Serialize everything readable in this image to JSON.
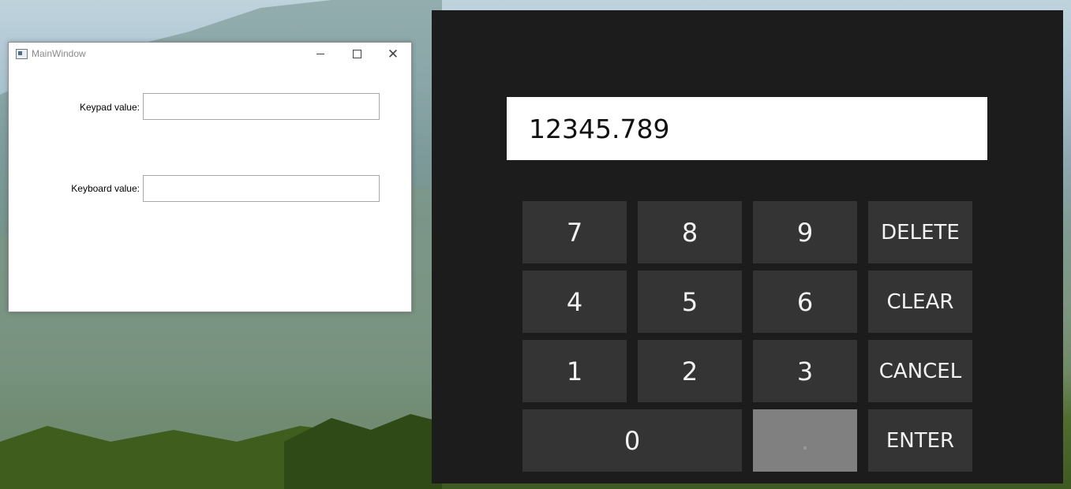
{
  "window": {
    "title": "MainWindow",
    "fields": [
      {
        "label": "Keypad value:",
        "value": ""
      },
      {
        "label": "Keyboard value:",
        "value": ""
      }
    ]
  },
  "keypad": {
    "display": "12345.789",
    "keys": {
      "k7": "7",
      "k8": "8",
      "k9": "9",
      "delete": "DELETE",
      "k4": "4",
      "k5": "5",
      "k6": "6",
      "clear": "CLEAR",
      "k1": "1",
      "k2": "2",
      "k3": "3",
      "cancel": "CANCEL",
      "k0": "0",
      "dot": ".",
      "enter": "ENTER"
    }
  },
  "colors": {
    "keypad_bg": "#1c1c1c",
    "key_bg": "#343434",
    "key_pressed_bg": "#808080",
    "window_bg": "#ffffff"
  },
  "icons": [
    "app-window-icon",
    "minimize-icon",
    "maximize-icon",
    "close-icon"
  ]
}
